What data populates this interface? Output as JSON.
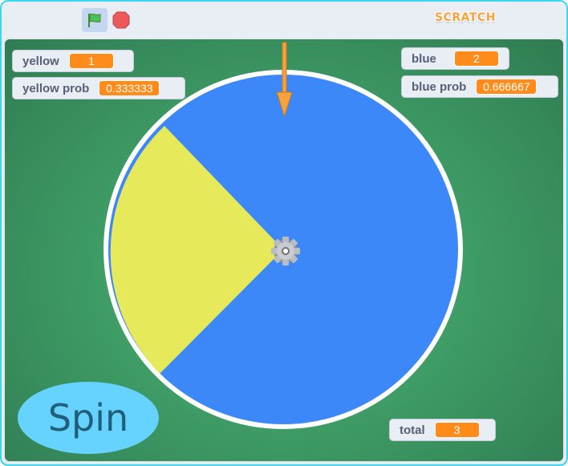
{
  "toolbar": {
    "green_flag_icon": "green-flag-icon",
    "stop_icon": "stop-sign-icon",
    "logo_text": "SCRATCH"
  },
  "monitors": {
    "yellow": {
      "label": "yellow",
      "value": "1"
    },
    "yellow_prob": {
      "label": "yellow prob",
      "value": "0.333333"
    },
    "blue": {
      "label": "blue",
      "value": "2"
    },
    "blue_prob": {
      "label": "blue prob",
      "value": "0.666667"
    },
    "total": {
      "label": "total",
      "value": "3"
    }
  },
  "spinner": {
    "sections": [
      {
        "color": "#3d88f9",
        "fraction": 0.6667
      },
      {
        "color": "#e6ea5a",
        "fraction": 0.3333
      }
    ],
    "pointer_color": "#f7a23c",
    "center_icon": "gear-icon"
  },
  "spin_button": {
    "label": "Spin"
  },
  "colors": {
    "accent_frame": "#39d8f0",
    "monitor_value": "#ff8c1a",
    "stage_green": "#3f9d66",
    "spin_button": "#66d3ff"
  }
}
